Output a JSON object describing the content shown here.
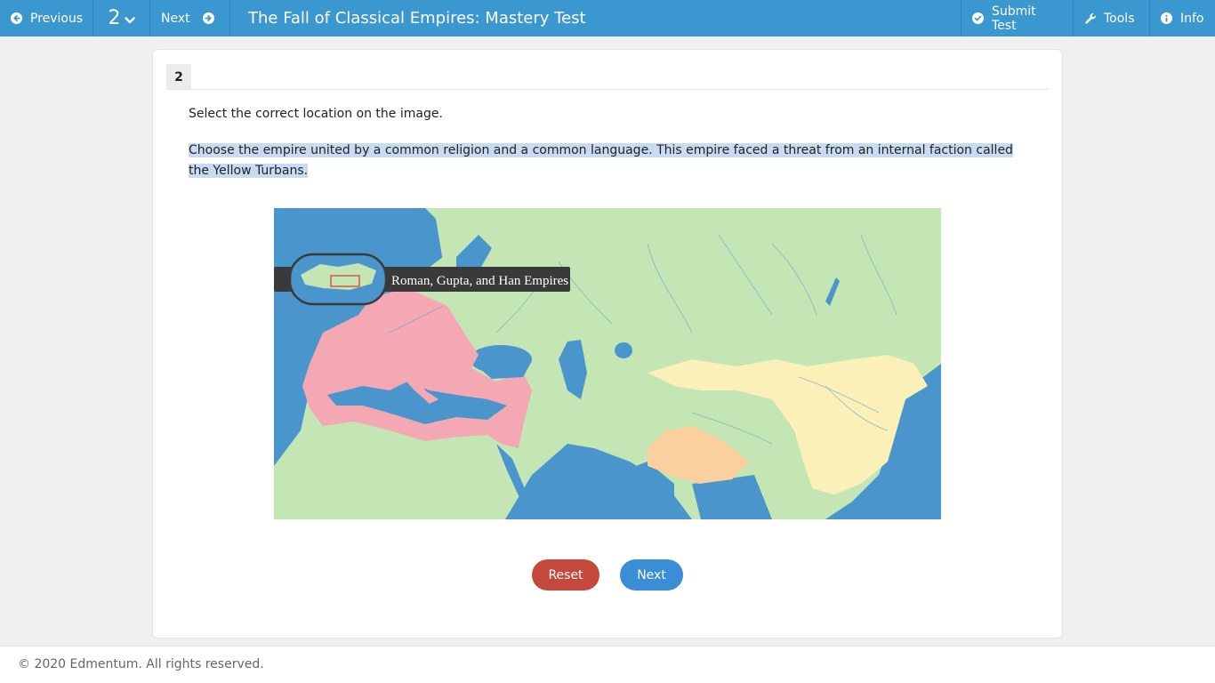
{
  "toolbar": {
    "previous_label": "Previous",
    "question_number": "2",
    "next_label": "Next",
    "title": "The Fall of Classical Empires: Mastery Test",
    "submit_label": "Submit Test",
    "tools_label": "Tools",
    "info_label": "Info"
  },
  "question": {
    "number": "2",
    "instruction": "Select the correct location on the image.",
    "prompt": "Choose the empire united by a common religion and a common language. This empire faced a threat from an internal faction called the Yellow Turbans."
  },
  "map": {
    "legend_title": "Roman, Gupta, and Han Empires",
    "colors": {
      "ocean": "#4a96cc",
      "land": "#c3e6b4",
      "roman": "#f4a8b3",
      "gupta": "#fbcf9e",
      "han": "#fbf0b8"
    }
  },
  "buttons": {
    "reset_label": "Reset",
    "next_label": "Next"
  },
  "footer": {
    "copyright": "© 2020 Edmentum. All rights reserved."
  },
  "colors": {
    "toolbar": "#3a97cf",
    "reset": "#c4493a",
    "next": "#3a8ed5"
  }
}
